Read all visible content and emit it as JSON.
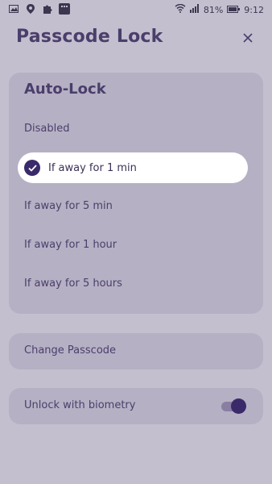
{
  "status_bar": {
    "battery": "81%",
    "time": "9:12",
    "icons": [
      "image-icon",
      "location-icon",
      "puzzle-icon",
      "grid-app-icon",
      "wifi-icon",
      "signal-icon",
      "battery-icon"
    ]
  },
  "header": {
    "title": "Passcode Lock",
    "close_icon": "close-icon"
  },
  "autolock": {
    "title": "Auto-Lock",
    "options": [
      "Disabled",
      "If away for 1 min",
      "If away for 5 min",
      "If away for 1 hour",
      "If away for 5 hours"
    ],
    "selected": "If away for 1 min"
  },
  "passcode": {
    "label": "Change Passcode"
  },
  "biometry": {
    "label": "Unlock with biometry",
    "enabled": true
  },
  "colors": {
    "background": "#c4bfcf",
    "card": "#b6b0c4",
    "accent": "#3a2a6a",
    "text": "#4a3f6b"
  }
}
